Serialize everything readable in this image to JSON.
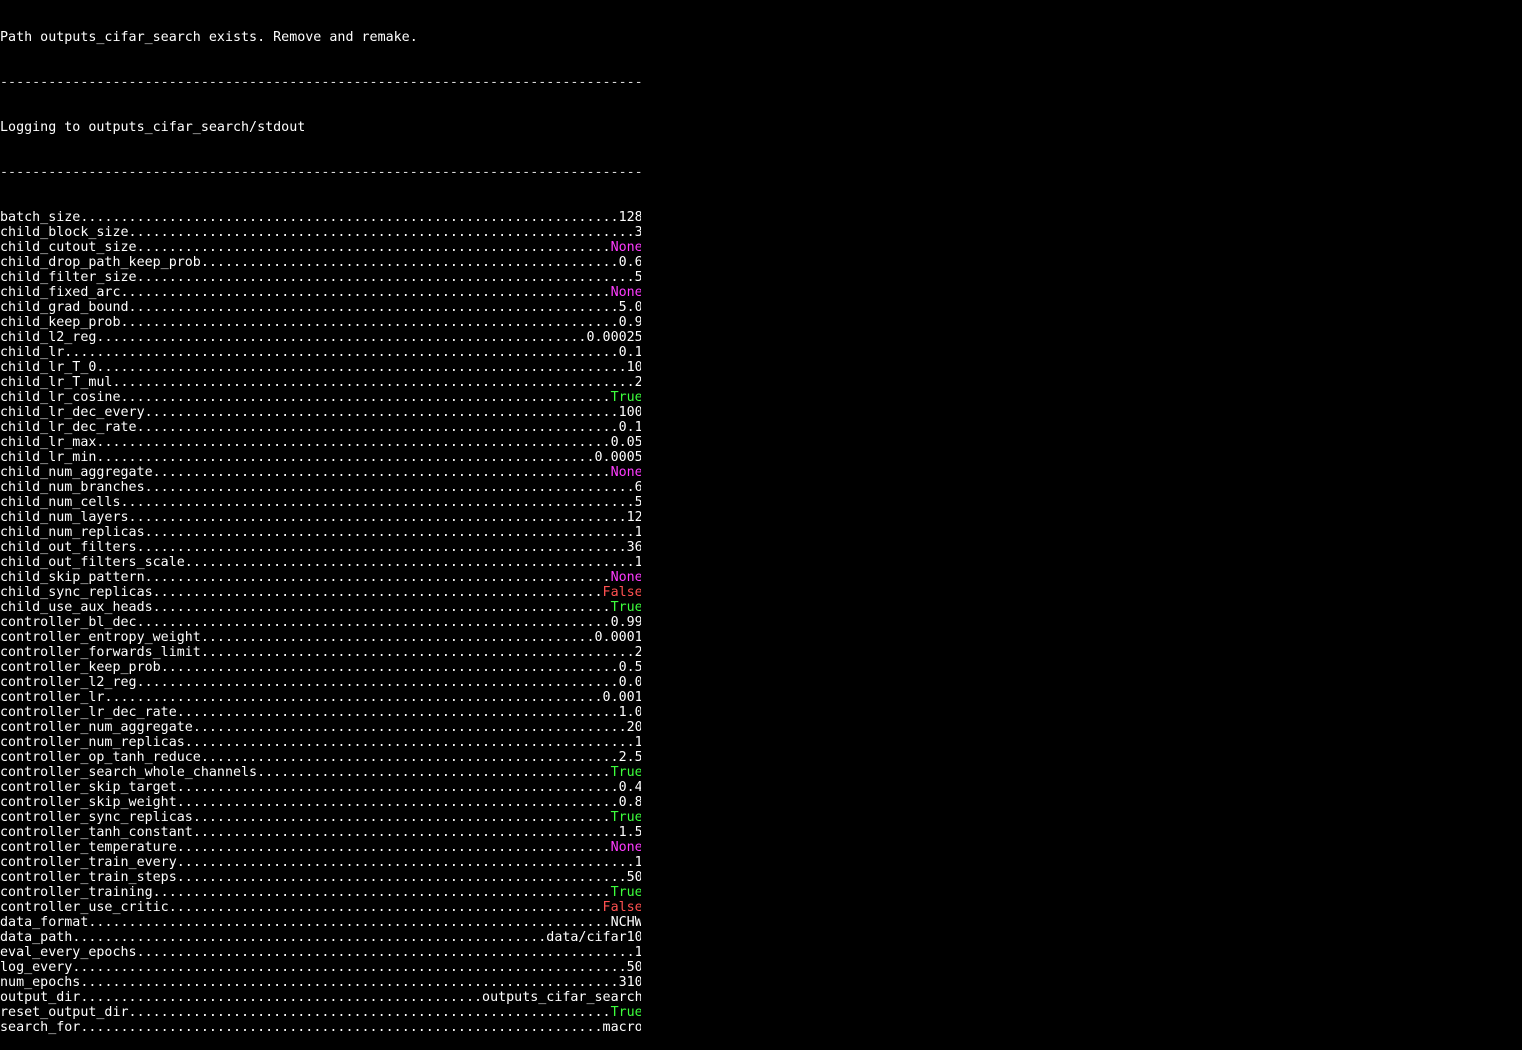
{
  "terminal": {
    "header_message": "Path outputs_cifar_search exists. Remove and remake.",
    "separator": "--------------------------------------------------------------------------------",
    "logging_message": "Logging to outputs_cifar_search/stdout",
    "line_width_chars": 80,
    "colors": {
      "background": "#000000",
      "text": "#ffffff",
      "none_value": "#ff3cff",
      "true_value": "#3cff3c",
      "false_value": "#ff5050"
    },
    "flags": [
      {
        "name": "batch_size",
        "value": "128",
        "kind": "plain"
      },
      {
        "name": "child_block_size",
        "value": "3",
        "kind": "plain"
      },
      {
        "name": "child_cutout_size",
        "value": "None",
        "kind": "none"
      },
      {
        "name": "child_drop_path_keep_prob",
        "value": "0.6",
        "kind": "plain"
      },
      {
        "name": "child_filter_size",
        "value": "5",
        "kind": "plain"
      },
      {
        "name": "child_fixed_arc",
        "value": "None",
        "kind": "none"
      },
      {
        "name": "child_grad_bound",
        "value": "5.0",
        "kind": "plain"
      },
      {
        "name": "child_keep_prob",
        "value": "0.9",
        "kind": "plain"
      },
      {
        "name": "child_l2_reg",
        "value": "0.00025",
        "kind": "plain"
      },
      {
        "name": "child_lr",
        "value": "0.1",
        "kind": "plain"
      },
      {
        "name": "child_lr_T_0",
        "value": "10",
        "kind": "plain"
      },
      {
        "name": "child_lr_T_mul",
        "value": "2",
        "kind": "plain"
      },
      {
        "name": "child_lr_cosine",
        "value": "True",
        "kind": "true"
      },
      {
        "name": "child_lr_dec_every",
        "value": "100",
        "kind": "plain"
      },
      {
        "name": "child_lr_dec_rate",
        "value": "0.1",
        "kind": "plain"
      },
      {
        "name": "child_lr_max",
        "value": "0.05",
        "kind": "plain"
      },
      {
        "name": "child_lr_min",
        "value": "0.0005",
        "kind": "plain"
      },
      {
        "name": "child_num_aggregate",
        "value": "None",
        "kind": "none"
      },
      {
        "name": "child_num_branches",
        "value": "6",
        "kind": "plain"
      },
      {
        "name": "child_num_cells",
        "value": "5",
        "kind": "plain"
      },
      {
        "name": "child_num_layers",
        "value": "12",
        "kind": "plain"
      },
      {
        "name": "child_num_replicas",
        "value": "1",
        "kind": "plain"
      },
      {
        "name": "child_out_filters",
        "value": "36",
        "kind": "plain"
      },
      {
        "name": "child_out_filters_scale",
        "value": "1",
        "kind": "plain"
      },
      {
        "name": "child_skip_pattern",
        "value": "None",
        "kind": "none"
      },
      {
        "name": "child_sync_replicas",
        "value": "False",
        "kind": "false"
      },
      {
        "name": "child_use_aux_heads",
        "value": "True",
        "kind": "true"
      },
      {
        "name": "controller_bl_dec",
        "value": "0.99",
        "kind": "plain"
      },
      {
        "name": "controller_entropy_weight",
        "value": "0.0001",
        "kind": "plain"
      },
      {
        "name": "controller_forwards_limit",
        "value": "2",
        "kind": "plain"
      },
      {
        "name": "controller_keep_prob",
        "value": "0.5",
        "kind": "plain"
      },
      {
        "name": "controller_l2_reg",
        "value": "0.0",
        "kind": "plain"
      },
      {
        "name": "controller_lr",
        "value": "0.001",
        "kind": "plain"
      },
      {
        "name": "controller_lr_dec_rate",
        "value": "1.0",
        "kind": "plain"
      },
      {
        "name": "controller_num_aggregate",
        "value": "20",
        "kind": "plain"
      },
      {
        "name": "controller_num_replicas",
        "value": "1",
        "kind": "plain"
      },
      {
        "name": "controller_op_tanh_reduce",
        "value": "2.5",
        "kind": "plain"
      },
      {
        "name": "controller_search_whole_channels",
        "value": "True",
        "kind": "true"
      },
      {
        "name": "controller_skip_target",
        "value": "0.4",
        "kind": "plain"
      },
      {
        "name": "controller_skip_weight",
        "value": "0.8",
        "kind": "plain"
      },
      {
        "name": "controller_sync_replicas",
        "value": "True",
        "kind": "true"
      },
      {
        "name": "controller_tanh_constant",
        "value": "1.5",
        "kind": "plain"
      },
      {
        "name": "controller_temperature",
        "value": "None",
        "kind": "none"
      },
      {
        "name": "controller_train_every",
        "value": "1",
        "kind": "plain"
      },
      {
        "name": "controller_train_steps",
        "value": "50",
        "kind": "plain"
      },
      {
        "name": "controller_training",
        "value": "True",
        "kind": "true"
      },
      {
        "name": "controller_use_critic",
        "value": "False",
        "kind": "false"
      },
      {
        "name": "data_format",
        "value": "NCHW",
        "kind": "plain"
      },
      {
        "name": "data_path",
        "value": "data/cifar10",
        "kind": "plain"
      },
      {
        "name": "eval_every_epochs",
        "value": "1",
        "kind": "plain"
      },
      {
        "name": "log_every",
        "value": "50",
        "kind": "plain"
      },
      {
        "name": "num_epochs",
        "value": "310",
        "kind": "plain"
      },
      {
        "name": "output_dir",
        "value": "outputs_cifar_search",
        "kind": "plain"
      },
      {
        "name": "reset_output_dir",
        "value": "True",
        "kind": "true"
      },
      {
        "name": "search_for",
        "value": "macro",
        "kind": "plain"
      }
    ]
  }
}
